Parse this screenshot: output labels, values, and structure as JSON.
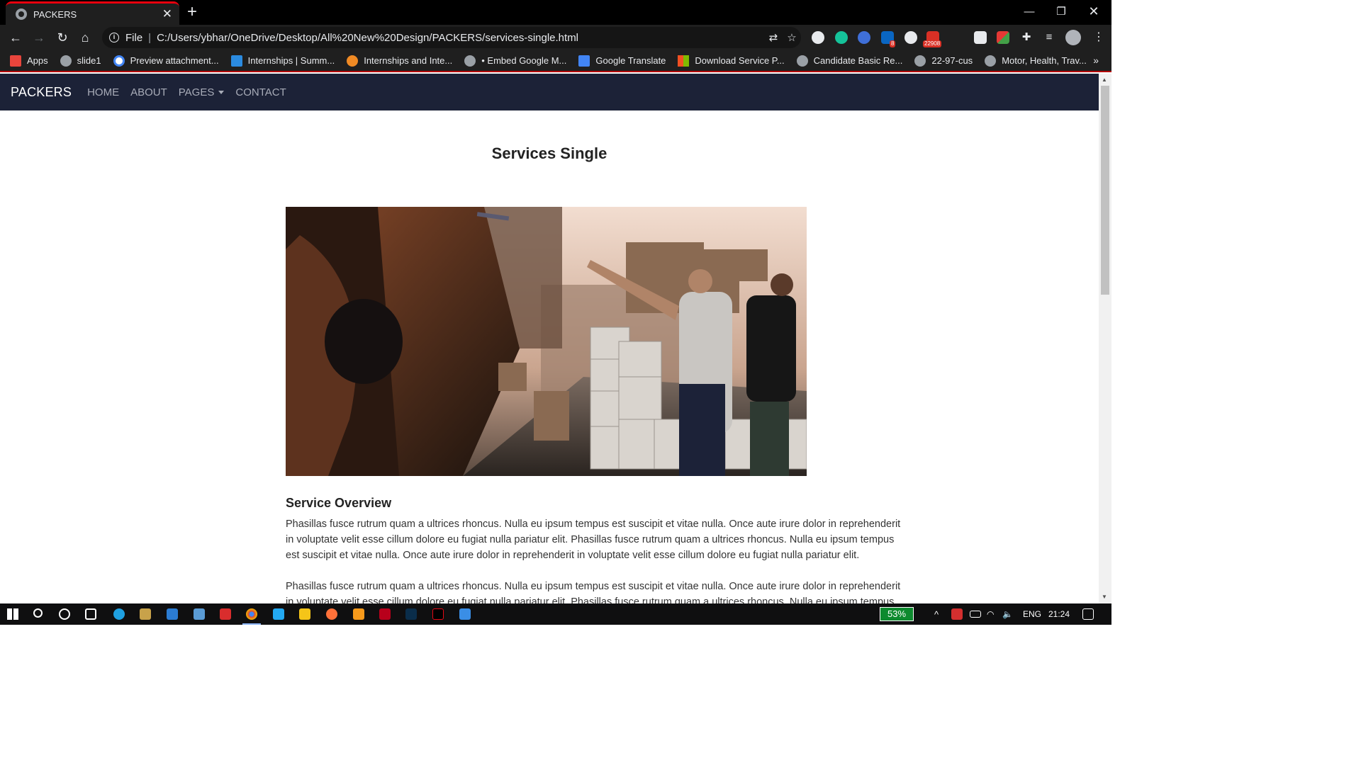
{
  "browser": {
    "tab_title": "PACKERS",
    "omnibox": {
      "file_label": "File",
      "url": "C:/Users/ybhar/OneDrive/Desktop/All%20New%20Design/PACKERS/services-single.html"
    },
    "extension_badges": {
      "linkedin": "8",
      "gmail": "22908"
    },
    "bookmarks": [
      {
        "label": "Apps",
        "icon": "apps-grid-icon",
        "color": "#e8453c"
      },
      {
        "label": "slide1",
        "icon": "globe-icon",
        "color": "#9aa0a6"
      },
      {
        "label": "Preview attachment...",
        "icon": "google-icon",
        "color": "#ffffff"
      },
      {
        "label": "Internships | Summ...",
        "icon": "is-icon",
        "color": "#2b8be0"
      },
      {
        "label": "Internships and Inte...",
        "icon": "flame-icon",
        "color": "#f08a24"
      },
      {
        "label": "• Embed Google M...",
        "icon": "globe-icon",
        "color": "#9aa0a6"
      },
      {
        "label": "Google Translate",
        "icon": "translate-icon",
        "color": "#4285f4"
      },
      {
        "label": "Download Service P...",
        "icon": "microsoft-icon",
        "color": "#f25022"
      },
      {
        "label": "Candidate Basic Re...",
        "icon": "globe-icon",
        "color": "#9aa0a6"
      },
      {
        "label": "22-97-cus",
        "icon": "globe-icon",
        "color": "#9aa0a6"
      },
      {
        "label": "Motor, Health, Trav...",
        "icon": "globe-icon",
        "color": "#9aa0a6"
      }
    ]
  },
  "site": {
    "brand": "PACKERS",
    "nav": [
      {
        "label": "HOME"
      },
      {
        "label": "ABOUT"
      },
      {
        "label": "PAGES"
      },
      {
        "label": "CONTACT"
      }
    ],
    "page_title": "Services Single",
    "overview_heading": "Service Overview",
    "paragraph_1": "Phasillas fusce rutrum quam a ultrices rhoncus. Nulla eu ipsum tempus est suscipit et vitae nulla. Once aute irure dolor in reprehenderit in voluptate velit esse cillum dolore eu fugiat nulla pariatur elit. Phasillas fusce rutrum quam a ultrices rhoncus. Nulla eu ipsum tempus est suscipit et vitae nulla. Once aute irure dolor in reprehenderit in voluptate velit esse cillum dolore eu fugiat nulla pariatur elit.",
    "paragraph_2": "Phasillas fusce rutrum quam a ultrices rhoncus. Nulla eu ipsum tempus est suscipit et vitae nulla. Once aute irure dolor in reprehenderit in voluptate velit esse cillum dolore eu fugiat nulla pariatur elit. Phasillas fusce rutrum quam a ultrices rhoncus. Nulla eu ipsum tempus est suscipit et vitae nulla. Once aute irure dolor in reprehenderit"
  },
  "taskbar": {
    "battery_percent": "53%",
    "language": "ENG",
    "time": "21:24"
  }
}
